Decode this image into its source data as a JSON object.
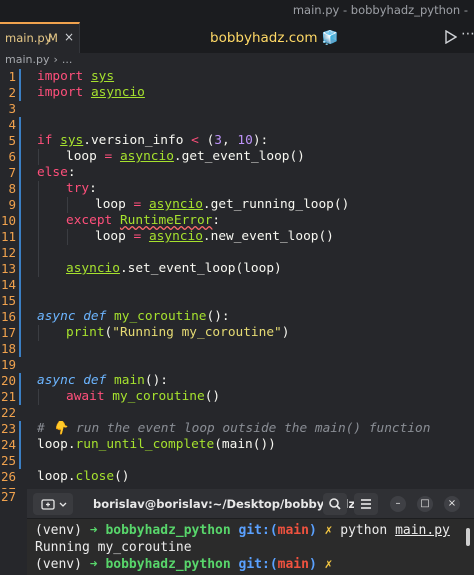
{
  "window": {
    "title": "main.py - bobbyhadz_python -"
  },
  "tab": {
    "label": "main.py",
    "status": "M",
    "close": "×"
  },
  "brand": {
    "text": "bobbyhadz.com 🧊"
  },
  "breadcrumb": {
    "file": "main.py",
    "separator": "›",
    "more": "..."
  },
  "editor": {
    "line_numbers": [
      "1",
      "2",
      "3",
      "4",
      "5",
      "6",
      "7",
      "8",
      "9",
      "10",
      "11",
      "12",
      "13",
      "14",
      "15",
      "16",
      "17",
      "18",
      "19",
      "20",
      "21",
      "22",
      "23",
      "24",
      "25",
      "26",
      "27"
    ],
    "code": {
      "l1_kw": "import",
      "l1_mod": "sys",
      "l2_kw": "import",
      "l2_mod": "asyncio",
      "l5_kw": "if",
      "l5_mod": "sys",
      "l5_rest": ".version_info ",
      "l5_op": "<",
      "l5_p1": " (",
      "l5_n1": "3",
      "l5_comma": ", ",
      "l5_n2": "10",
      "l5_p2": "):",
      "l6_var": "loop ",
      "l6_eq": "=",
      "l6_sp": " ",
      "l6_mod": "asyncio",
      "l6_rest": ".get_event_loop()",
      "l7_kw": "else",
      "l7_colon": ":",
      "l8_kw": "try",
      "l8_colon": ":",
      "l9_var": "loop ",
      "l9_eq": "=",
      "l9_sp": " ",
      "l9_mod": "asyncio",
      "l9_rest": ".get_running_loop()",
      "l10_kw": "except",
      "l10_sp": " ",
      "l10_err": "RuntimeError",
      "l10_colon": ":",
      "l11_var": "loop ",
      "l11_eq": "=",
      "l11_sp": " ",
      "l11_mod": "asyncio",
      "l11_rest": ".new_event_loop()",
      "l13_mod": "asyncio",
      "l13_rest": ".set_event_loop(loop)",
      "l16_kw": "async def",
      "l16_fn": " my_coroutine",
      "l16_rest": "():",
      "l17_fn": "print",
      "l17_p1": "(",
      "l17_str": "\"Running my_coroutine\"",
      "l17_p2": ")",
      "l20_kw": "async def",
      "l20_fn": " main",
      "l20_rest": "():",
      "l21_kw": "await",
      "l21_fn": " my_coroutine",
      "l21_rest": "()",
      "l23_cm": "# 👇 run the event loop outside the main() function",
      "l24_a": "loop.",
      "l24_fn": "run_until_complete",
      "l24_rest": "(main())",
      "l26_a": "loop.",
      "l26_fn": "close",
      "l26_rest": "()"
    }
  },
  "terminal": {
    "title": "borislav@borislav:~/Desktop/bobbyhadz...",
    "minimize": "–",
    "maximize": "□",
    "close": "×",
    "line1": {
      "venv": "(venv) ",
      "arrow": "➜ ",
      "dir": "bobbyhadz_python ",
      "git": "git:(",
      "branch": "main",
      "git_end": ") ",
      "dirty": "✗ ",
      "cmd": "python ",
      "arg": "main.py"
    },
    "line2": "Running my_coroutine",
    "line3": {
      "venv": "(venv) ",
      "arrow": "➜ ",
      "dir": "bobbyhadz_python ",
      "git": "git:(",
      "branch": "main",
      "git_end": ") ",
      "dirty": "✗"
    }
  },
  "colors": {
    "accent_orange": "#f0a24e",
    "keyword_pink": "#ff4f7b",
    "green": "#a6e22e",
    "brand_yellow": "#ffd966"
  },
  "icons": [
    "run-icon",
    "more-icon",
    "terminal-new-icon",
    "search-icon",
    "menu-icon"
  ]
}
